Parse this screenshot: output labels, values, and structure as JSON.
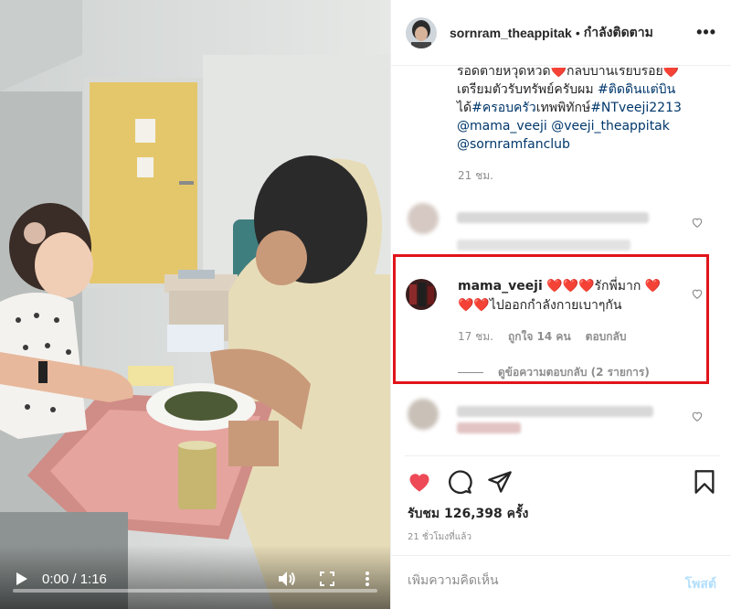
{
  "video": {
    "time": "0:00 / 1:16",
    "progress": 0.0,
    "icons": [
      "play-icon",
      "volume-icon",
      "fullscreen-icon",
      "more-vertical-icon"
    ]
  },
  "header": {
    "username": "sornram_theappitak",
    "separator": "•",
    "follow_status": "กำลังติดตาม",
    "more": "•••"
  },
  "caption": {
    "line1": "รอดตายหวุดหวด❤️กลับบ้านเรียบร้อย❤️",
    "line2_text": "เตรียมตัวรับทรัพย์ครับผม ",
    "line2_tag": "#ติดดินแต่บิน",
    "line3_text": "ได้",
    "line3_tag1": "#ครอบครัว",
    "line3_text2": "เทพพิทักษ์",
    "line3_tag2": "#NTveeji2213",
    "mention1": "@mama_veeji",
    "mention2": "@veeji_theappitak",
    "mention3": "@sornramfanclub",
    "time": "21 ชม."
  },
  "comment": {
    "username": "mama_veeji",
    "text_a": " ❤️❤️❤️รักพี่มาก ❤️",
    "text_b": "❤️❤️ไปออกกำลังกายเบาๆกัน",
    "time": "17 ชม.",
    "likes": "ถูกใจ 14 คน",
    "reply": "ตอบกลับ",
    "view_replies": "ดูข้อความตอบกลับ (2 รายการ)"
  },
  "stats": {
    "views": "รับชม 126,398 ครั้ง",
    "posted": "21 ชั่วโมงที่แล้ว"
  },
  "add_comment": {
    "placeholder": "เพิ่มความคิดเห็น",
    "post": "โพสต์"
  },
  "colors": {
    "highlight": "#e1141b",
    "like_red": "#ed4956",
    "link": "#00376b",
    "post_disabled": "#b2dffc"
  }
}
